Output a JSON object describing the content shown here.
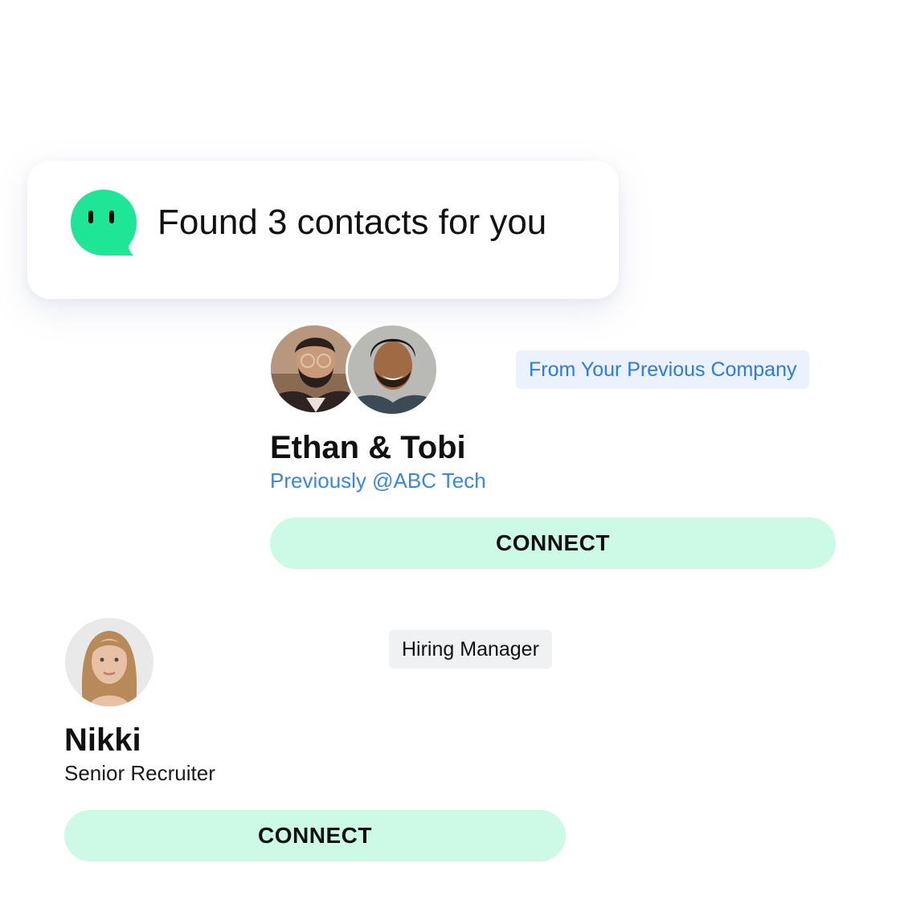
{
  "notification": {
    "text": "Found 3 contacts for you",
    "icon": "chat-bot-icon",
    "icon_color": "#1fe597"
  },
  "contacts": [
    {
      "names": "Ethan & Tobi",
      "subtitle": "Previously @ABC Tech",
      "tag": "From Your Previous Company",
      "button_label": "CONNECT",
      "avatars": [
        "ethan-avatar",
        "tobi-avatar"
      ]
    },
    {
      "names": "Nikki",
      "subtitle": "Senior Recruiter",
      "tag": "Hiring Manager",
      "button_label": "CONNECT",
      "avatars": [
        "nikki-avatar"
      ]
    }
  ],
  "colors": {
    "accent_green": "#1fe597",
    "button_bg": "#cdf9e7",
    "link_blue": "#3a86e6",
    "tag_blue_bg": "#ebf2fd",
    "tag_gray_bg": "#f0f1f3"
  }
}
